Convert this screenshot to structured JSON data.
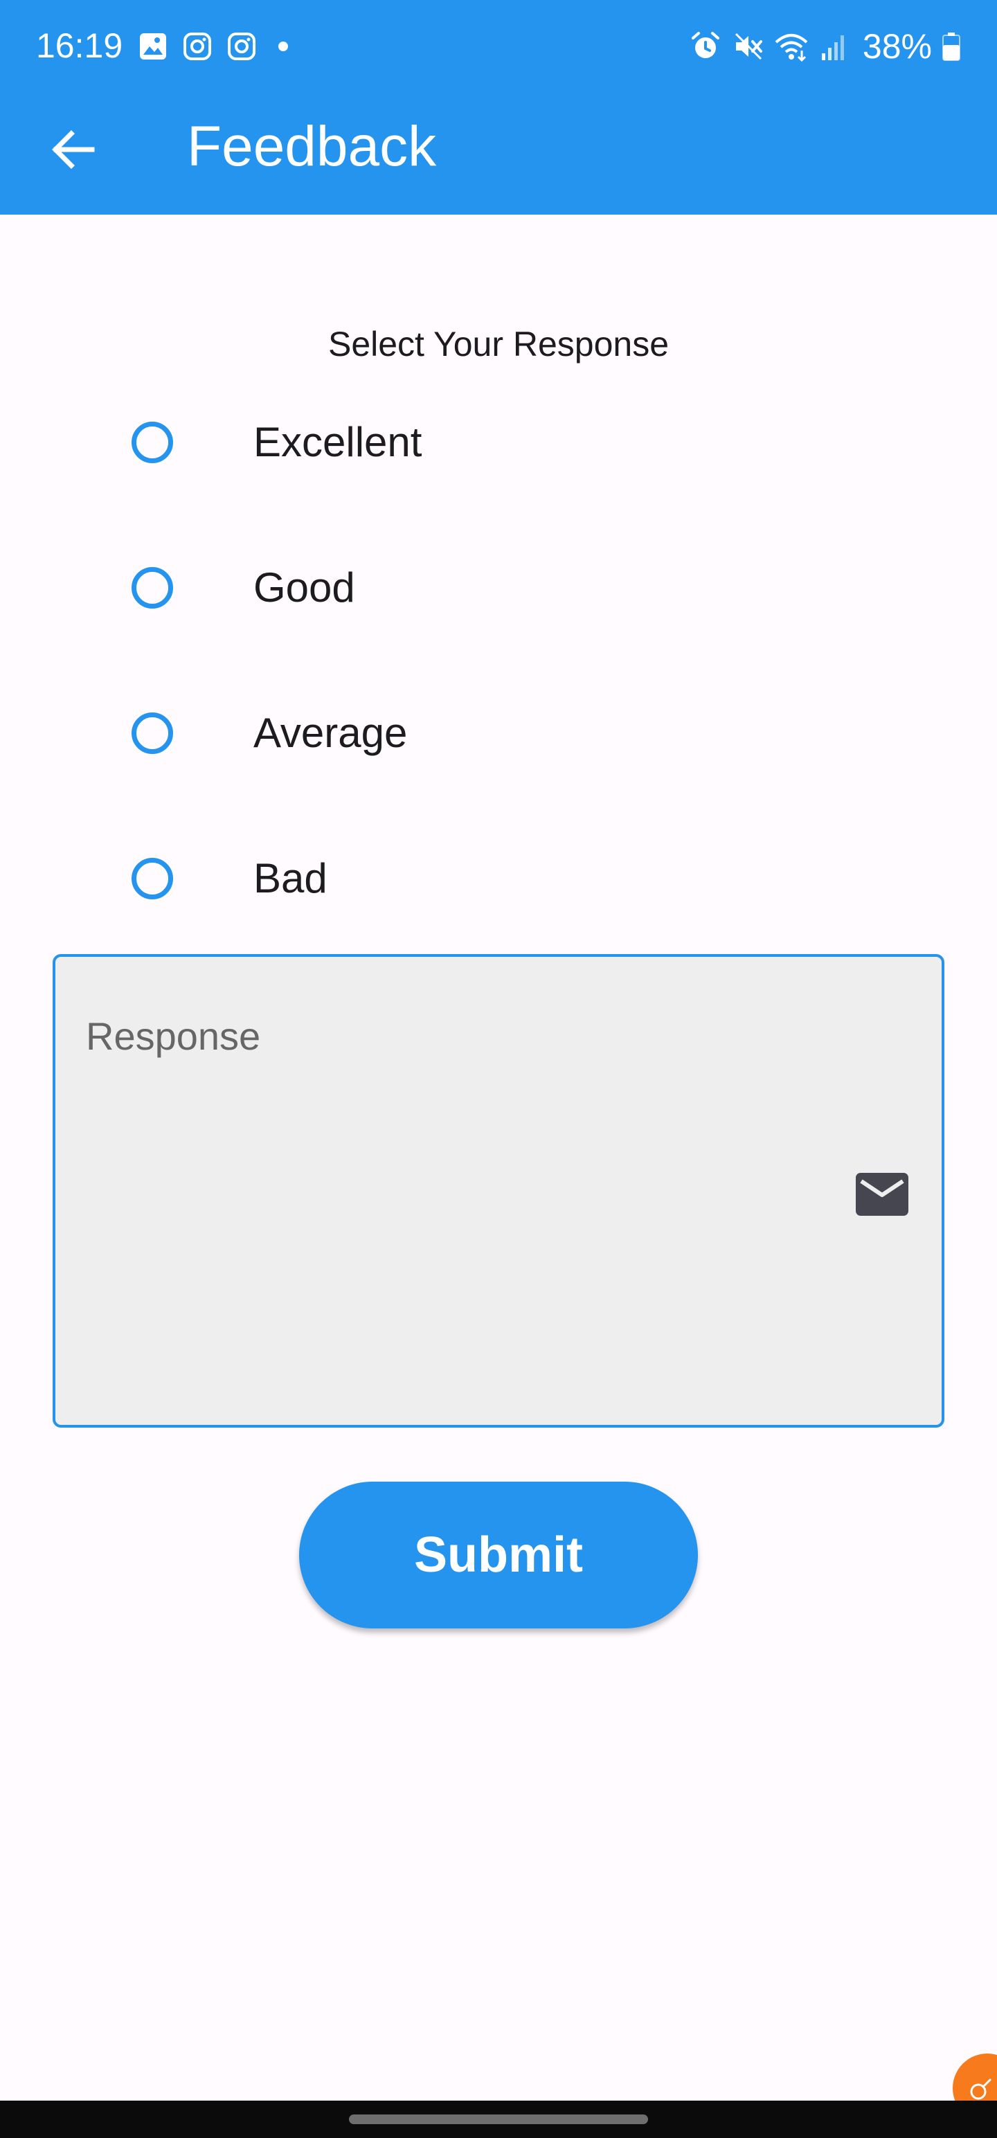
{
  "status_bar": {
    "time": "16:19",
    "battery": "38%",
    "left_icons": [
      "gallery-icon",
      "instagram-icon",
      "instagram-icon",
      "notification-dot-icon"
    ],
    "right_icons": [
      "alarm-icon",
      "mute-icon",
      "wifi-icon",
      "signal-icon",
      "battery-icon"
    ]
  },
  "app_bar": {
    "title": "Feedback",
    "back_icon": "arrow-back-icon",
    "color": "#2594ee"
  },
  "form": {
    "heading": "Select Your Response",
    "options": [
      {
        "label": "Excellent",
        "selected": false
      },
      {
        "label": "Good",
        "selected": false
      },
      {
        "label": "Average",
        "selected": false
      },
      {
        "label": "Bad",
        "selected": false
      }
    ],
    "response_field": {
      "placeholder": "Response",
      "value": "",
      "icon": "mail-icon"
    },
    "submit_label": "Submit"
  },
  "colors": {
    "accent": "#2594ee",
    "background": "#fffbfe",
    "field_fill": "#eeeeee"
  }
}
